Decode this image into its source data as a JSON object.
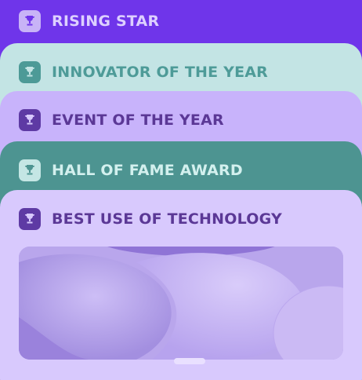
{
  "awards": [
    {
      "title": "RISING STAR",
      "icon": "trophy-icon"
    },
    {
      "title": "INNOVATOR OF THE YEAR",
      "icon": "trophy-icon"
    },
    {
      "title": "EVENT OF THE YEAR",
      "icon": "trophy-icon"
    },
    {
      "title": "HALL OF FAME AWARD",
      "icon": "trophy-icon"
    },
    {
      "title": "BEST USE OF TECHNOLOGY",
      "icon": "trophy-icon",
      "expanded": true
    }
  ],
  "colors": {
    "violet": "#6f35ea",
    "mint": "#c3e4e4",
    "lavender": "#c8b3fb",
    "teal": "#4d9491",
    "light_lavender": "#d8c9fd"
  }
}
